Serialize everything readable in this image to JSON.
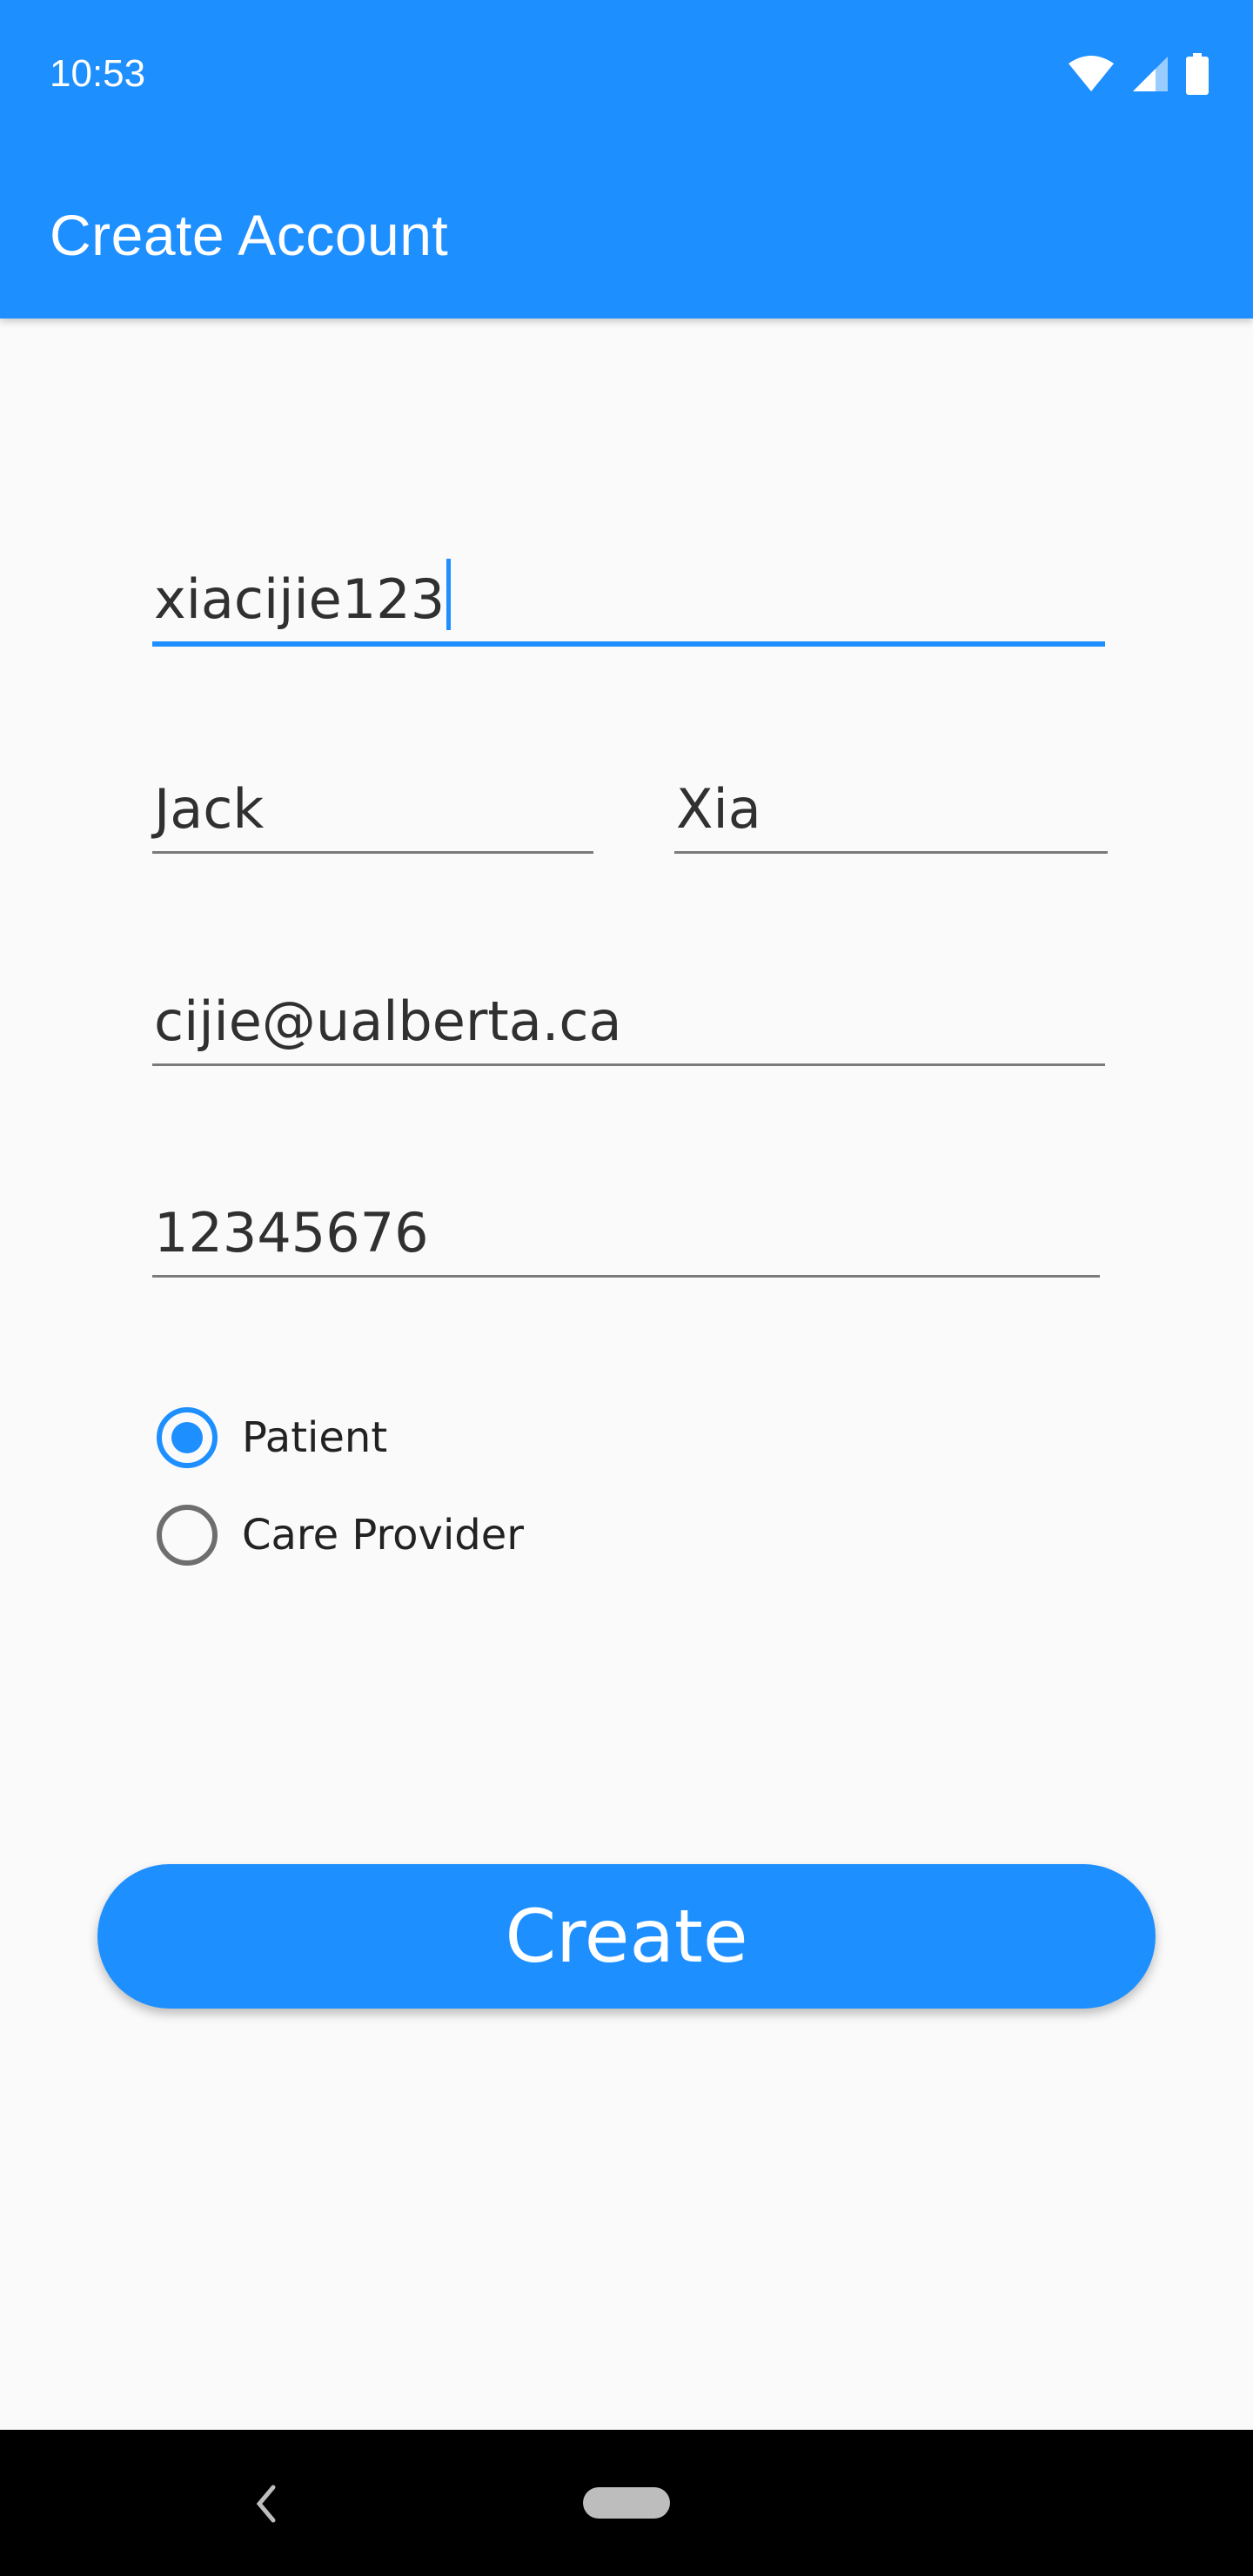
{
  "status_bar": {
    "time": "10:53",
    "icons": [
      "wifi-icon",
      "signal-icon",
      "battery-icon"
    ]
  },
  "app_bar": {
    "title": "Create Account"
  },
  "form": {
    "username": {
      "value": "xiacijie123",
      "focused": true
    },
    "first_name": {
      "value": "Jack"
    },
    "last_name": {
      "value": "Xia"
    },
    "email": {
      "value": "cijie@ualberta.ca"
    },
    "password": {
      "value": "12345676"
    },
    "role_options": [
      {
        "label": "Patient",
        "selected": true
      },
      {
        "label": "Care Provider",
        "selected": false
      }
    ],
    "submit_label": "Create"
  },
  "nav_bar": {
    "icons": [
      "back-icon",
      "home-pill-icon"
    ]
  },
  "colors": {
    "primary": "#1E8FFF",
    "background": "#FAFAFA",
    "nav_bar": "#000000"
  }
}
